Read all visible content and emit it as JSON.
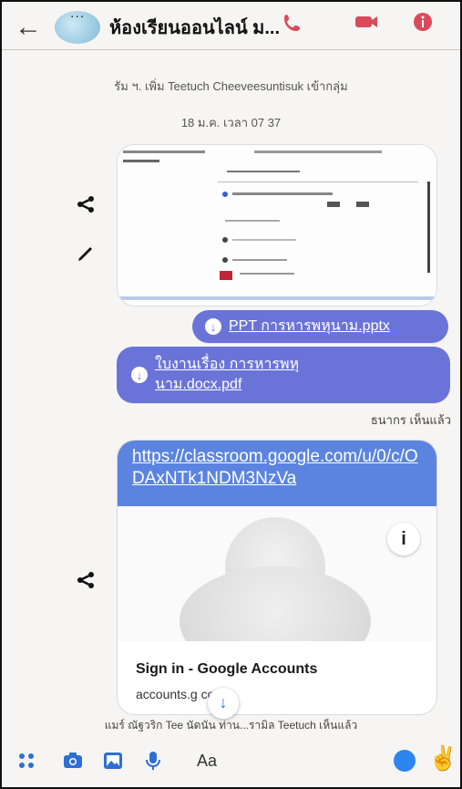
{
  "header": {
    "title": "ห้องเรียนออนไลน์ ม...",
    "avatar_dots": "..."
  },
  "system": {
    "added_text": "รัม ฯ. เพิ่ม Teetuch Cheeveesuntisuk เข้ากลุ่ม",
    "timestamp": "18 ม.ค. เวลา 07 37"
  },
  "messages": {
    "file1": "PPT การหารพหุนาม.pptx",
    "file2": "ใบงานเรื่อง การหารพหุนาม.docx.pdf",
    "seen1": "ธนากร เห็นแล้ว",
    "link_url": "https://classroom.google.com/u/0/c/ODAxNTk1NDM3NzVa",
    "link_title": "Sign in - Google Accounts",
    "link_domain": "accounts.g      com",
    "seen2": "แมร์ ณัฐวริก Tee นัดนัน ท่าน...รามิล Teetuch เห็นแล้ว"
  },
  "composer": {
    "placeholder": "Aa"
  },
  "colors": {
    "accent": "#6a74d8",
    "link_header": "#5b84e0",
    "icon_blue": "#2f6ed4",
    "icon_red": "#d94b5a"
  }
}
